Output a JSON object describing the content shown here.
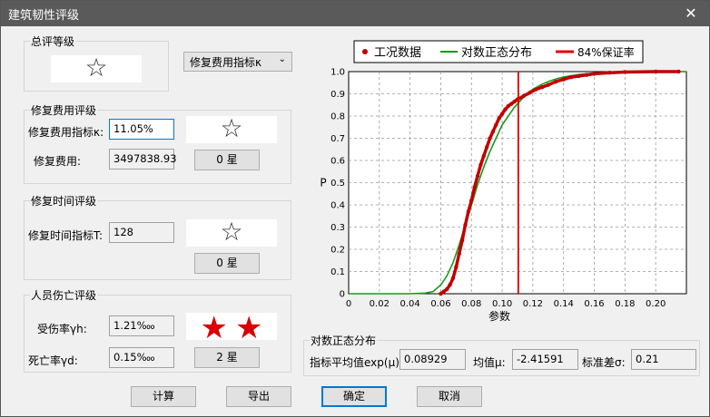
{
  "window": {
    "title": "建筑韧性评级",
    "close_glyph": "✕"
  },
  "overall": {
    "label": "总评等级",
    "star": "☆",
    "dropdown_value": "修复费用指标κ",
    "dropdown_arrow": "⌄"
  },
  "cost": {
    "label": "修复费用评级",
    "index_label": "修复费用指标κ:",
    "index_value": "11.05%",
    "cost_label": "修复费用:",
    "cost_value": "3497838.93",
    "star": "☆",
    "rating": "0 星"
  },
  "time": {
    "label": "修复时间评级",
    "index_label": "修复时间指标T:",
    "index_value": "128",
    "star": "☆",
    "rating": "0 星"
  },
  "casualty": {
    "label": "人员伤亡评级",
    "injury_label": "受伤率γh:",
    "injury_value": "1.21‱",
    "death_label": "死亡率γd:",
    "death_value": "0.15‱",
    "stars": [
      "★",
      "★"
    ],
    "rating": "2 星"
  },
  "lognormal": {
    "label": "对数正态分布",
    "mean_label": "指标平均值exp(μ):",
    "mean_value": "0.08929",
    "mu_label": "均值μ:",
    "mu_value": "-2.41591",
    "sigma_label": "标准差σ:",
    "sigma_value": "0.21"
  },
  "buttons": {
    "calc": "计算",
    "export": "导出",
    "ok": "确定",
    "cancel": "取消"
  },
  "chart_data": {
    "type": "line",
    "xlabel": "参数",
    "ylabel": "P",
    "xlim": [
      0,
      0.22
    ],
    "ylim": [
      0,
      1
    ],
    "x_ticks": [
      "0",
      "0.02",
      "0.04",
      "0.06",
      "0.08",
      "0.10",
      "0.12",
      "0.14",
      "0.16",
      "0.18",
      "0.20"
    ],
    "y_ticks": [
      "0",
      "0.1",
      "0.2",
      "0.3",
      "0.4",
      "0.5",
      "0.6",
      "0.7",
      "0.8",
      "0.9",
      "1.0"
    ],
    "grid": true,
    "legend_position": "top",
    "series": [
      {
        "name": "工况数据",
        "color": "#c00000",
        "style": "points",
        "x": [
          0.06,
          0.062,
          0.064,
          0.066,
          0.068,
          0.07,
          0.072,
          0.074,
          0.076,
          0.078,
          0.08,
          0.082,
          0.084,
          0.086,
          0.088,
          0.09,
          0.092,
          0.094,
          0.096,
          0.098,
          0.1,
          0.102,
          0.104,
          0.106,
          0.108,
          0.11,
          0.114,
          0.118,
          0.122,
          0.126,
          0.13,
          0.135,
          0.14,
          0.145,
          0.15,
          0.155,
          0.16,
          0.17,
          0.18,
          0.2,
          0.215
        ],
        "y": [
          0.0,
          0.01,
          0.02,
          0.04,
          0.07,
          0.12,
          0.18,
          0.24,
          0.31,
          0.37,
          0.42,
          0.48,
          0.53,
          0.58,
          0.62,
          0.66,
          0.7,
          0.73,
          0.76,
          0.79,
          0.81,
          0.83,
          0.845,
          0.855,
          0.865,
          0.875,
          0.89,
          0.905,
          0.92,
          0.93,
          0.94,
          0.955,
          0.965,
          0.975,
          0.98,
          0.985,
          0.99,
          0.995,
          0.998,
          1.0,
          1.0
        ]
      },
      {
        "name": "对数正态分布",
        "color": "#1a9a1a",
        "style": "line",
        "x": [
          0.0,
          0.04,
          0.05,
          0.055,
          0.06,
          0.064,
          0.068,
          0.072,
          0.076,
          0.08,
          0.084,
          0.088,
          0.092,
          0.096,
          0.1,
          0.104,
          0.108,
          0.112,
          0.116,
          0.12,
          0.125,
          0.13,
          0.135,
          0.14,
          0.15,
          0.16,
          0.17,
          0.18,
          0.2,
          0.22
        ],
        "y": [
          0.0,
          0.0,
          0.003,
          0.01,
          0.04,
          0.08,
          0.14,
          0.22,
          0.31,
          0.4,
          0.49,
          0.57,
          0.64,
          0.7,
          0.76,
          0.8,
          0.84,
          0.87,
          0.9,
          0.92,
          0.94,
          0.955,
          0.967,
          0.976,
          0.987,
          0.993,
          0.996,
          0.998,
          0.9995,
          1.0
        ]
      },
      {
        "name": "84%保证率",
        "color": "#e00000",
        "style": "vline",
        "x": [
          0.1105
        ]
      }
    ]
  }
}
